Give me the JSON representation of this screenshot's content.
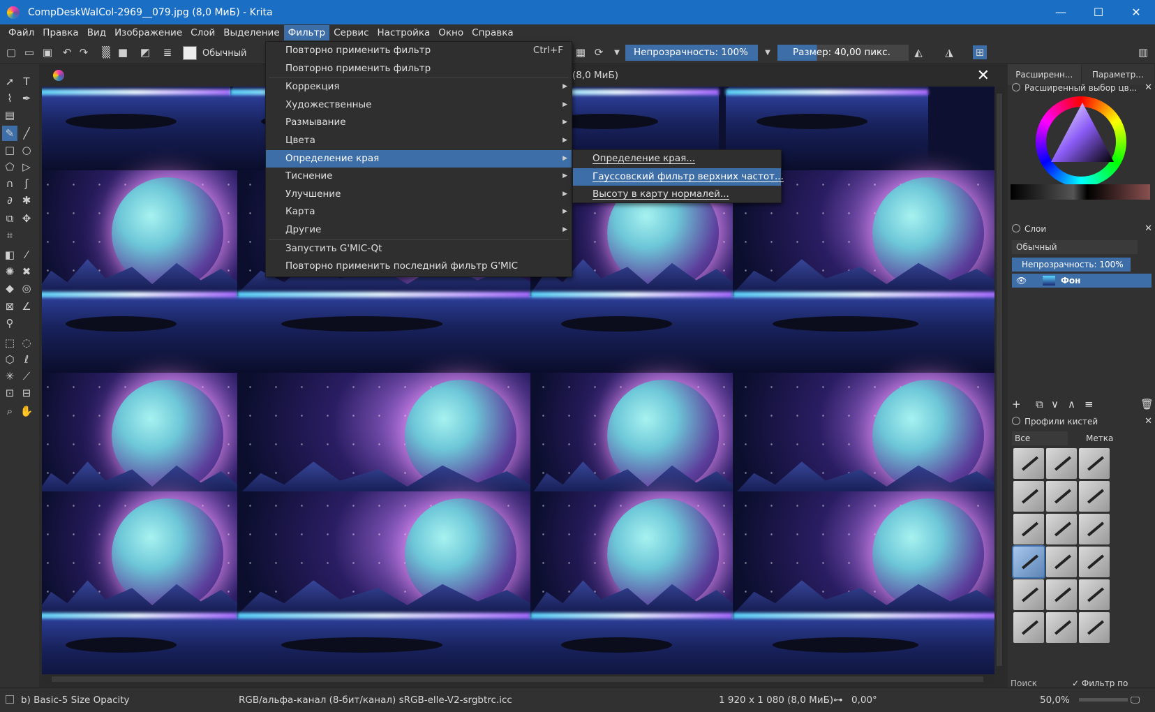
{
  "window": {
    "title": "CompDeskWalCol-2969__079.jpg (8,0 МиБ)  - Krita",
    "controls": {
      "minimize": "—",
      "maximize": "☐",
      "close": "✕"
    }
  },
  "menubar": [
    "Файл",
    "Правка",
    "Вид",
    "Изображение",
    "Слой",
    "Выделение",
    "Фильтр",
    "Сервис",
    "Настройка",
    "Окно",
    "Справка"
  ],
  "toolbar": {
    "blend_mode": "Обычный",
    "opacity": "Непрозрачность: 100%",
    "size": "Размер: 40,00 пикс."
  },
  "document_tab": {
    "size_label": "(8,0 МиБ)",
    "close": "✕"
  },
  "filter_menu": {
    "items": [
      {
        "label": "Повторно применить фильтр",
        "shortcut": "Ctrl+F"
      },
      {
        "label": "Повторно применить фильтр",
        "shortcut": ""
      },
      {
        "label": "Коррекция",
        "has_submenu": true
      },
      {
        "label": "Художественные",
        "has_submenu": true
      },
      {
        "label": "Размывание",
        "has_submenu": true
      },
      {
        "label": "Цвета",
        "has_submenu": true
      },
      {
        "label": "Определение края",
        "has_submenu": true,
        "highlighted": true
      },
      {
        "label": "Тиснение",
        "has_submenu": true
      },
      {
        "label": "Улучшение",
        "has_submenu": true
      },
      {
        "label": "Карта",
        "has_submenu": true
      },
      {
        "label": "Другие",
        "has_submenu": true
      },
      {
        "label": "Запустить G'MIC-Qt"
      },
      {
        "label": "Повторно применить последний фильтр G'MIC"
      }
    ],
    "submenu": [
      {
        "label": "Определение края..."
      },
      {
        "label": "Гауссовский фильтр верхних частот...",
        "highlighted": true
      },
      {
        "label": "Высоту в карту нормалей..."
      }
    ]
  },
  "docker": {
    "tabs": [
      "Расширенн...",
      "Параметр..."
    ],
    "color_selector_title": "Расширенный выбор цв...",
    "layers_title": "Слои",
    "layers_blend": "Обычный",
    "layers_opacity": "Непрозрачность: 100%",
    "layer_name": "Фон",
    "brush_presets_title": "Профили кистей",
    "brush_filter": "Все",
    "brush_tag": "Метка",
    "brush_search": "Поиск",
    "brush_filter_by_tag": "Фильтр по метке"
  },
  "statusbar": {
    "brush": "b) Basic-5 Size Opacity",
    "color_space": "RGB/альфа-канал (8-бит/канал)  sRGB-elle-V2-srgbtrc.icc",
    "image_size": "1 920 x 1 080 (8,0 МиБ)",
    "rotation": "0,00°",
    "zoom": "50,0%"
  },
  "colors": {
    "title_bar": "#1a6fc4",
    "accent": "#3d6ea8",
    "panel": "#313131"
  }
}
